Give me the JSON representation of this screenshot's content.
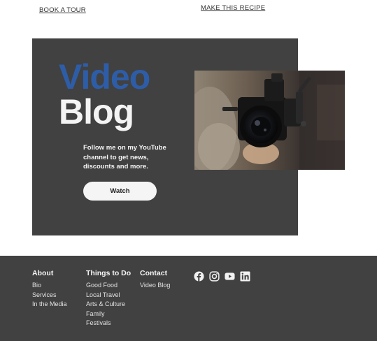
{
  "top_links": {
    "tour": "BOOK A TOUR",
    "recipe": "MAKE THIS RECIPE"
  },
  "promo": {
    "headline_line1": "Video",
    "headline_line2": "Blog",
    "text": "Follow me on my YouTube channel to get news, discounts and more.",
    "button_label": "Watch"
  },
  "footer": {
    "about": {
      "heading": "About",
      "links": [
        "Bio",
        "Services",
        "In the Media"
      ]
    },
    "things": {
      "heading": "Things to Do",
      "links": [
        "Good Food",
        "Local Travel",
        "Arts & Culture",
        "Family",
        "Festivals"
      ]
    },
    "contact": {
      "heading": "Contact",
      "links": [
        "Video Blog"
      ]
    },
    "social": [
      "facebook-icon",
      "instagram-icon",
      "youtube-icon",
      "linkedin-icon"
    ]
  },
  "colors": {
    "panel": "#414141",
    "accent_blue": "#2e5da8",
    "light": "#f5f5f5"
  }
}
